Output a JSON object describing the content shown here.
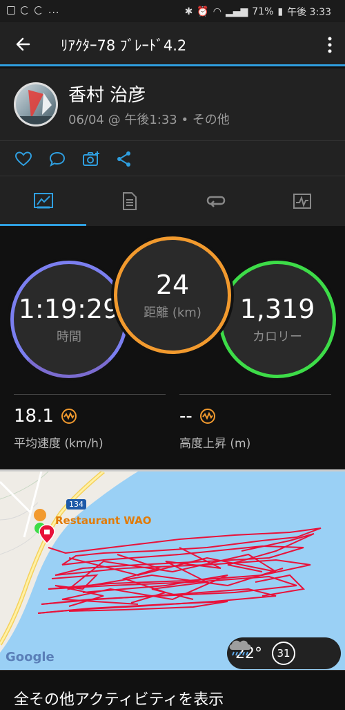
{
  "status_bar": {
    "dots": "...",
    "battery": "71%",
    "time": "午後 3:33"
  },
  "app_bar": {
    "title": "ﾘｱｸﾀｰ78 ﾌﾞﾚｰﾄﾞ4.2"
  },
  "activity": {
    "user_name": "香村 治彦",
    "meta": "06/04 @ 午後1:33 • その他"
  },
  "social": [
    "heart-icon",
    "comment-icon",
    "camera-icon",
    "share-icon"
  ],
  "tabs": [
    "overview-icon",
    "details-icon",
    "laps-icon",
    "charts-icon"
  ],
  "stats": {
    "time_value": "1:19:29",
    "time_label": "時間",
    "distance_value": "24",
    "distance_label": "距離 (km)",
    "calories_value": "1,319",
    "calories_label": "カロリー",
    "avg_speed_value": "18.1",
    "avg_speed_label": "平均速度 (km/h)",
    "elevation_value": "--",
    "elevation_label": "高度上昇 (m)"
  },
  "map": {
    "road_number": "134",
    "place_name": "Restaurant WAO",
    "attribution": "Google",
    "weather_temp": "22°",
    "wind_speed": "31"
  },
  "footer": {
    "link_text": "全その他アクティビティを表示"
  },
  "colors": {
    "accent": "#2f9fe0",
    "time_ring": "#7b7ff0",
    "distance_ring": "#f29a2e",
    "calories_ring": "#3ddc48",
    "track": "#e8123a"
  }
}
